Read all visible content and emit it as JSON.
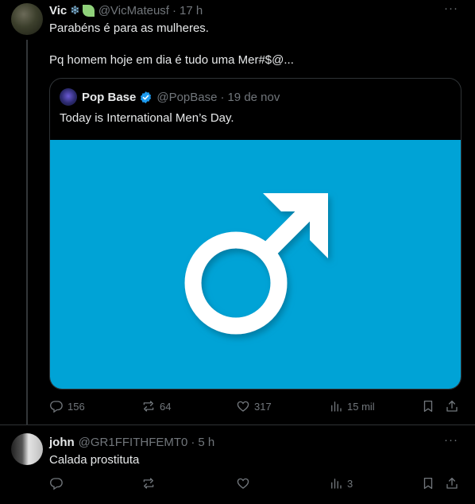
{
  "tweets": [
    {
      "author": {
        "name": "Vic",
        "handle": "@VicMateusf",
        "time": "17 h",
        "emoji": [
          "snowflake",
          "leaf"
        ]
      },
      "text": [
        "Parabéns é para as mulheres.",
        "Pq homem hoje em dia é tudo uma Mer#$@..."
      ],
      "quote": {
        "author": {
          "name": "Pop Base",
          "handle": "@PopBase",
          "date": "19 de nov",
          "verified": true
        },
        "text": "Today is International Men’s Day.",
        "image": {
          "symbol": "male-symbol",
          "background": "#00a3d6"
        }
      },
      "actions": {
        "replies": "156",
        "reposts": "64",
        "likes": "317",
        "views": "15 mil"
      }
    },
    {
      "author": {
        "name": "john",
        "handle": "@GR1FFITHFEMT0",
        "time": "5 h"
      },
      "text": "Calada prostituta",
      "actions": {
        "replies": "",
        "reposts": "",
        "likes": "",
        "views": "3"
      }
    }
  ],
  "separator": "·",
  "more_label": "···",
  "colors": {
    "background": "#000000",
    "text": "#e7e9ea",
    "muted": "#71767b",
    "border": "#2f3336",
    "verified": "#1d9bf0",
    "image_bg": "#00a3d6"
  }
}
